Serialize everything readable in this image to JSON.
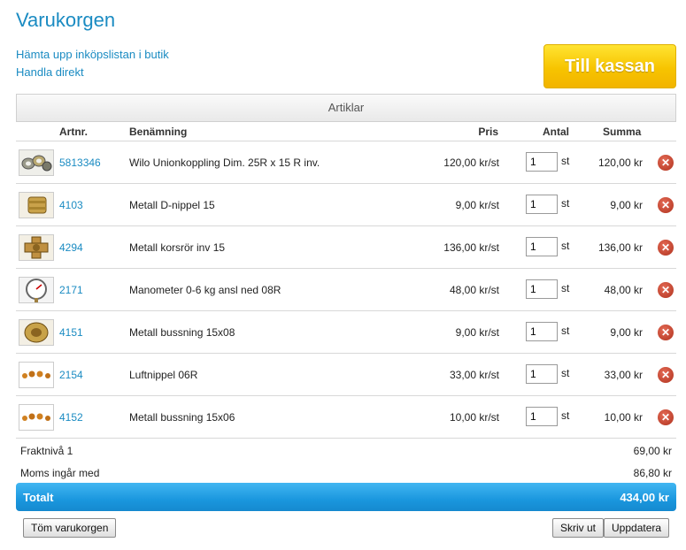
{
  "page": {
    "title": "Varukorgen",
    "links": [
      "Hämta upp inköpslistan i butik",
      "Handla direkt"
    ],
    "checkout_label": "Till kassan",
    "section_title": "Artiklar"
  },
  "columns": {
    "artnr": "Artnr.",
    "name": "Benämning",
    "price": "Pris",
    "qty": "Antal",
    "sum": "Summa"
  },
  "items": [
    {
      "artnr": "5813346",
      "name": "Wilo Unionkoppling Dim. 25R x 15 R inv.",
      "price": "120,00 kr/st",
      "qty": "1",
      "unit": "st",
      "sum": "120,00 kr",
      "thumb": "union-coupling"
    },
    {
      "artnr": "4103",
      "name": "Metall D-nippel 15",
      "price": "9,00 kr/st",
      "qty": "1",
      "unit": "st",
      "sum": "9,00 kr",
      "thumb": "brass-nipple"
    },
    {
      "artnr": "4294",
      "name": "Metall korsrör inv 15",
      "price": "136,00 kr/st",
      "qty": "1",
      "unit": "st",
      "sum": "136,00 kr",
      "thumb": "brass-cross"
    },
    {
      "artnr": "2171",
      "name": "Manometer 0-6 kg ansl ned 08R",
      "price": "48,00 kr/st",
      "qty": "1",
      "unit": "st",
      "sum": "48,00 kr",
      "thumb": "pressure-gauge"
    },
    {
      "artnr": "4151",
      "name": "Metall bussning 15x08",
      "price": "9,00 kr/st",
      "qty": "1",
      "unit": "st",
      "sum": "9,00 kr",
      "thumb": "brass-bushing"
    },
    {
      "artnr": "2154",
      "name": "Luftnippel 06R",
      "price": "33,00 kr/st",
      "qty": "1",
      "unit": "st",
      "sum": "33,00 kr",
      "thumb": "air-nipples"
    },
    {
      "artnr": "4152",
      "name": "Metall bussning 15x06",
      "price": "10,00 kr/st",
      "qty": "1",
      "unit": "st",
      "sum": "10,00 kr",
      "thumb": "air-nipples"
    }
  ],
  "summary": {
    "shipping_label": "Fraktnivå 1",
    "shipping_value": "69,00 kr",
    "vat_label": "Moms ingår med",
    "vat_value": "86,80 kr",
    "total_label": "Totalt",
    "total_value": "434,00 kr"
  },
  "buttons": {
    "clear": "Töm varukorgen",
    "print": "Skriv ut",
    "update": "Uppdatera"
  },
  "colors": {
    "link": "#1a8bc2",
    "checkout": "#f7c400",
    "total_bar": "#1a97de",
    "remove": "#b0331f"
  }
}
